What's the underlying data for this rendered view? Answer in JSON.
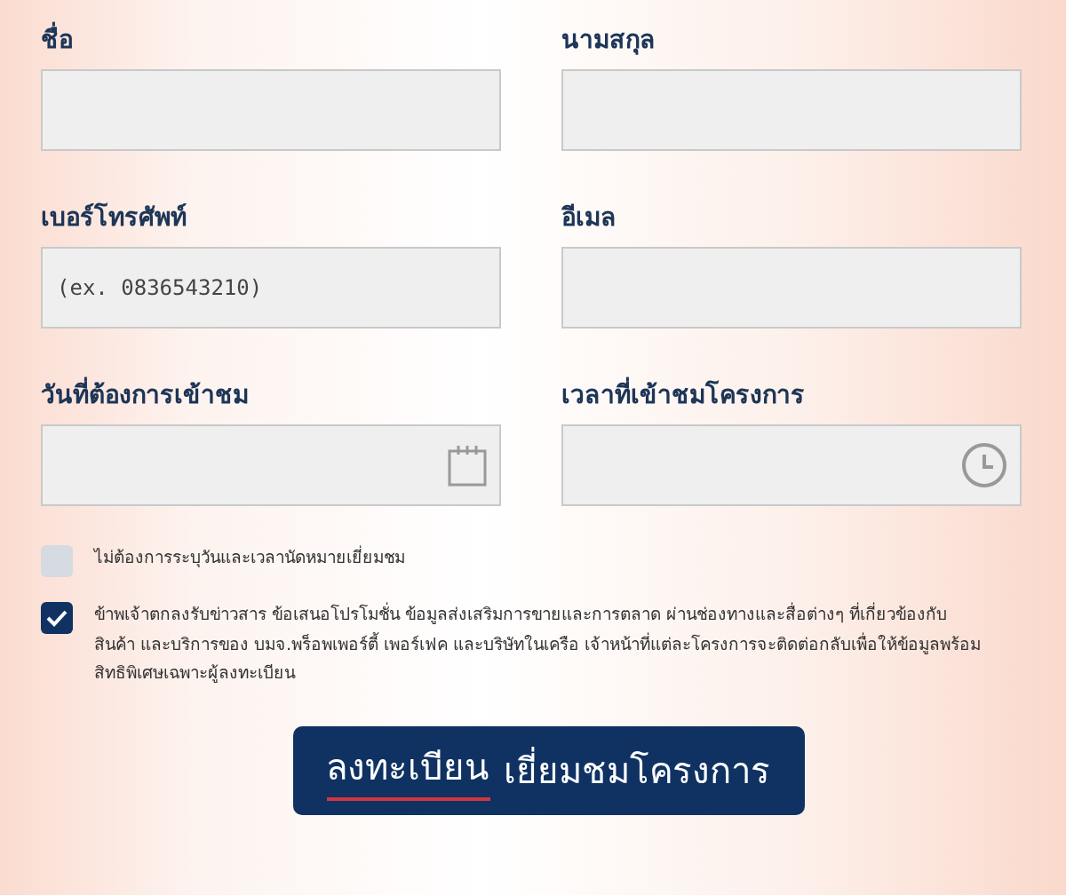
{
  "fields": [
    {
      "label": "ชื่อ",
      "kind": "text"
    },
    {
      "label": "นามสกุล",
      "kind": "text"
    },
    {
      "label": "เบอร์โทรศัพท์",
      "kind": "text",
      "placeholder": "(ex. 0836543210)"
    },
    {
      "label": "อีเมล",
      "kind": "text"
    },
    {
      "label": "วันที่ต้องการเข้าชม",
      "kind": "date"
    },
    {
      "label": "เวลาที่เข้าชมโครงการ",
      "kind": "time"
    }
  ],
  "checkboxes": [
    {
      "label": "ไม่ต้องการระบุวันและเวลานัดหมายเยี่ยมชม",
      "checked": false
    },
    {
      "label": "ข้าพเจ้าตกลงรับข่าวสาร ข้อเสนอโปรโมชั่น ข้อมูลส่งเสริมการขายและการตลาด ผ่านช่องทางและสื่อต่างๆ ที่เกี่ยวข้องกับสินค้า และบริการของ บมจ.พร็อพเพอร์ตี้ เพอร์เฟค และบริษัทในเครือ เจ้าหน้าที่แต่ละโครงการจะติดต่อกลับเพื่อให้ข้อมูลพร้อม สิทธิพิเศษเฉพาะผู้ลงทะเบียน",
      "checked": true
    }
  ],
  "submit": {
    "underlined": "ลงทะเบียน",
    "rest": "เยี่ยมชมโครงการ"
  }
}
